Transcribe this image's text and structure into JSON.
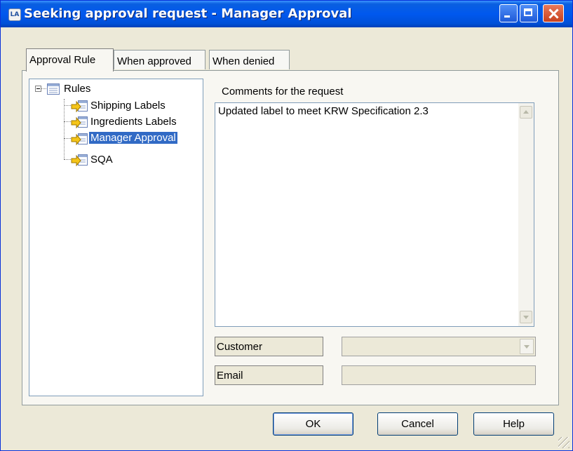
{
  "window": {
    "title": "Seeking approval request - Manager Approval",
    "icon": "app-icon",
    "controls": [
      "minimize",
      "maximize",
      "close"
    ]
  },
  "tabs": [
    {
      "label": "Approval Rule",
      "active": true
    },
    {
      "label": "When approved",
      "active": false
    },
    {
      "label": "When denied",
      "active": false
    }
  ],
  "tree": {
    "root": {
      "label": "Rules",
      "expanded": true,
      "icon": "rules-list-icon"
    },
    "children": [
      {
        "label": "Shipping Labels",
        "icon": "rule-arrow-icon",
        "selected": false
      },
      {
        "label": "Ingredients Labels",
        "icon": "rule-arrow-icon",
        "selected": false
      },
      {
        "label": "Manager Approval",
        "icon": "rule-arrow-icon",
        "selected": true
      },
      {
        "label": "SQA",
        "icon": "rule-arrow-icon",
        "selected": false
      }
    ]
  },
  "comments": {
    "label": "Comments for the request",
    "value": "Updated label to meet KRW Specification 2.3"
  },
  "fields": {
    "customer_label": "Customer",
    "customer_value": "",
    "email_label": "Email",
    "email_value": ""
  },
  "buttons": {
    "ok": "OK",
    "cancel": "Cancel",
    "help": "Help"
  },
  "colors": {
    "titlebar": "#0058EE",
    "selection": "#316AC5",
    "dialog_bg": "#ECE9D8"
  }
}
